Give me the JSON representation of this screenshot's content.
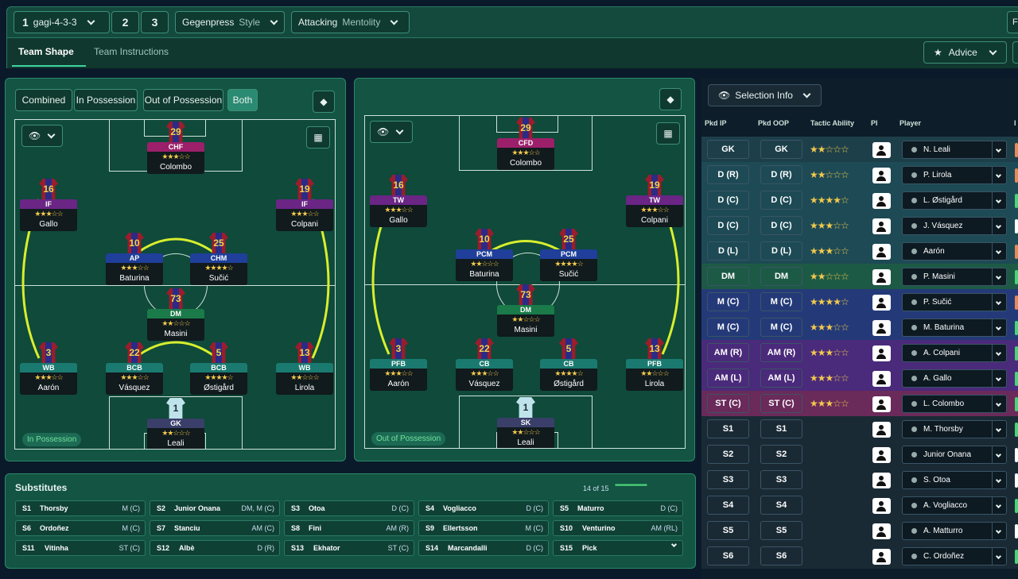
{
  "topbar": {
    "formation_num": "1",
    "formation_name": "gagi-4-3-3",
    "tab2": "2",
    "tab3": "3",
    "style_value": "Gegenpress",
    "style_label": "Style",
    "mentality_value": "Attacking",
    "mentality_label": "Mentolity",
    "far_right": "Fo"
  },
  "tabs": {
    "team_shape": "Team Shape",
    "team_instructions": "Team Instructions",
    "advice": "Advice"
  },
  "view_toggle": {
    "combined": "Combined",
    "in_possession": "In Possession",
    "out_of_possession": "Out of Possession",
    "both": "Both"
  },
  "left_pitch": {
    "label": "In Possession",
    "players": [
      {
        "num": "29",
        "role": "CHF",
        "name": "Colombo",
        "stars": "★★★☆☆",
        "color": "role-magenta"
      },
      {
        "num": "16",
        "role": "IF",
        "name": "Gallo",
        "stars": "★★★☆☆",
        "color": "role-purple"
      },
      {
        "num": "19",
        "role": "IF",
        "name": "Colpani",
        "stars": "★★★☆☆",
        "color": "role-purple"
      },
      {
        "num": "10",
        "role": "AP",
        "name": "Baturina",
        "stars": "★★★☆☆",
        "color": "role-blue"
      },
      {
        "num": "25",
        "role": "CHM",
        "name": "Sučić",
        "stars": "★★★★☆",
        "color": "role-blue"
      },
      {
        "num": "73",
        "role": "DM",
        "name": "Masini",
        "stars": "★★☆☆☆",
        "color": "role-green"
      },
      {
        "num": "3",
        "role": "WB",
        "name": "Aarón",
        "stars": "★★★☆☆",
        "color": "role-teal"
      },
      {
        "num": "22",
        "role": "BCB",
        "name": "Vásquez",
        "stars": "★★★☆☆",
        "color": "role-teal"
      },
      {
        "num": "5",
        "role": "BCB",
        "name": "Østigård",
        "stars": "★★★★☆",
        "color": "role-teal"
      },
      {
        "num": "13",
        "role": "WB",
        "name": "Lirola",
        "stars": "★★☆☆☆",
        "color": "role-teal"
      },
      {
        "num": "1",
        "role": "GK",
        "name": "Leali",
        "stars": "★★☆☆☆",
        "color": "role-gk"
      }
    ]
  },
  "right_pitch": {
    "label": "Out of Possession",
    "players": [
      {
        "num": "29",
        "role": "CFD",
        "name": "Colombo",
        "stars": "★★★☆☆",
        "color": "role-magenta"
      },
      {
        "num": "16",
        "role": "TW",
        "name": "Gallo",
        "stars": "★★★☆☆",
        "color": "role-purple"
      },
      {
        "num": "19",
        "role": "TW",
        "name": "Colpani",
        "stars": "★★★☆☆",
        "color": "role-purple"
      },
      {
        "num": "10",
        "role": "PCM",
        "name": "Baturina",
        "stars": "★★☆☆☆",
        "color": "role-blue"
      },
      {
        "num": "25",
        "role": "PCM",
        "name": "Sučić",
        "stars": "★★★★☆",
        "color": "role-blue"
      },
      {
        "num": "73",
        "role": "DM",
        "name": "Masini",
        "stars": "★★☆☆☆",
        "color": "role-green"
      },
      {
        "num": "3",
        "role": "PFB",
        "name": "Aarón",
        "stars": "★★★☆☆",
        "color": "role-teal"
      },
      {
        "num": "22",
        "role": "CB",
        "name": "Vásquez",
        "stars": "★★★☆☆",
        "color": "role-teal"
      },
      {
        "num": "5",
        "role": "CB",
        "name": "Østigård",
        "stars": "★★★★☆",
        "color": "role-teal"
      },
      {
        "num": "13",
        "role": "PFB",
        "name": "Lirola",
        "stars": "★★☆☆☆",
        "color": "role-teal"
      },
      {
        "num": "1",
        "role": "SK",
        "name": "Leali",
        "stars": "★★☆☆☆",
        "color": "role-gk"
      }
    ]
  },
  "substitutes": {
    "title": "Substitutes",
    "count": "14 of 15",
    "rows": [
      {
        "slot": "S1",
        "name": "Thorsby",
        "pos": "M (C)"
      },
      {
        "slot": "S2",
        "name": "Junior Onana",
        "pos": "DM, M (C)"
      },
      {
        "slot": "S3",
        "name": "Otoa",
        "pos": "D (C)"
      },
      {
        "slot": "S4",
        "name": "Vogliacco",
        "pos": "D (C)"
      },
      {
        "slot": "S5",
        "name": "Maturro",
        "pos": "D (C)"
      },
      {
        "slot": "S6",
        "name": "Ordoñez",
        "pos": "M (C)"
      },
      {
        "slot": "S7",
        "name": "Stanciu",
        "pos": "AM (C)"
      },
      {
        "slot": "S8",
        "name": "Fini",
        "pos": "AM (R)"
      },
      {
        "slot": "S9",
        "name": "Ellertsson",
        "pos": "M (C)"
      },
      {
        "slot": "S10",
        "name": "Venturino",
        "pos": "AM (RL)"
      },
      {
        "slot": "S11",
        "name": "Vitinha",
        "pos": "ST (C)"
      },
      {
        "slot": "S12",
        "name": "Albè",
        "pos": "D (R)"
      },
      {
        "slot": "S13",
        "name": "Ekhator",
        "pos": "ST (C)"
      },
      {
        "slot": "S14",
        "name": "Marcandalli",
        "pos": "D (C)"
      },
      {
        "slot": "S15",
        "name": "Pick",
        "pos": ""
      }
    ]
  },
  "selection": {
    "title": "Selection Info",
    "headers": {
      "pkd_ip": "Pkd IP",
      "pkd_oop": "Pkd OOP",
      "tactic": "Tactic Ability",
      "pi": "PI",
      "player": "Player",
      "extra": "I"
    },
    "rows": [
      {
        "ip": "GK",
        "oop": "GK",
        "stars": "★★☆☆☆",
        "player": "N. Leali",
        "bg": "#1d3f4a",
        "edge": "#e58a5a"
      },
      {
        "ip": "D (R)",
        "oop": "D (R)",
        "stars": "★★☆☆☆",
        "player": "P. Lirola",
        "bg": "#1d4a55",
        "edge": "#e58a5a"
      },
      {
        "ip": "D (C)",
        "oop": "D (C)",
        "stars": "★★★★☆",
        "player": "L. Østigård",
        "bg": "#1d4a55",
        "edge": "#4cd37a"
      },
      {
        "ip": "D (C)",
        "oop": "D (C)",
        "stars": "★★★☆☆",
        "player": "J. Vásquez",
        "bg": "#1d4a55",
        "edge": "#ffffff"
      },
      {
        "ip": "D (L)",
        "oop": "D (L)",
        "stars": "★★★☆☆",
        "player": "Aarón",
        "bg": "#1d4a55",
        "edge": "#e58a5a"
      },
      {
        "ip": "DM",
        "oop": "DM",
        "stars": "★★☆☆☆",
        "player": "P. Masini",
        "bg": "#1d5a45",
        "edge": "#4cd37a"
      },
      {
        "ip": "M (C)",
        "oop": "M (C)",
        "stars": "★★★★☆",
        "player": "P. Sučić",
        "bg": "#243a78",
        "edge": "#e58a5a"
      },
      {
        "ip": "M (C)",
        "oop": "M (C)",
        "stars": "★★★☆☆",
        "player": "M. Baturina",
        "bg": "#243a78",
        "edge": "#4cd37a"
      },
      {
        "ip": "AM (R)",
        "oop": "AM (R)",
        "stars": "★★★☆☆",
        "player": "A. Colpani",
        "bg": "#4a2a7a",
        "edge": "#4cd37a"
      },
      {
        "ip": "AM (L)",
        "oop": "AM (L)",
        "stars": "★★★☆☆",
        "player": "A. Gallo",
        "bg": "#4a2a7a",
        "edge": "#4cd37a"
      },
      {
        "ip": "ST (C)",
        "oop": "ST (C)",
        "stars": "★★★☆☆",
        "player": "L. Colombo",
        "bg": "#6a2a5a",
        "edge": "#4cd37a"
      },
      {
        "ip": "S1",
        "oop": "S1",
        "stars": "",
        "player": "M. Thorsby",
        "bg": "#1a2a35",
        "edge": "#4cd37a"
      },
      {
        "ip": "S2",
        "oop": "S2",
        "stars": "",
        "player": "Junior Onana",
        "bg": "#1a2a35",
        "edge": "#ffffff"
      },
      {
        "ip": "S3",
        "oop": "S3",
        "stars": "",
        "player": "S. Otoa",
        "bg": "#1a2a35",
        "edge": "#ffffff"
      },
      {
        "ip": "S4",
        "oop": "S4",
        "stars": "",
        "player": "A. Vogliacco",
        "bg": "#1a2a35",
        "edge": "#4cd37a"
      },
      {
        "ip": "S5",
        "oop": "S5",
        "stars": "",
        "player": "A. Matturro",
        "bg": "#1a2a35",
        "edge": "#ffffff"
      },
      {
        "ip": "S6",
        "oop": "S6",
        "stars": "",
        "player": "C. Ordoñez",
        "bg": "#1a2a35",
        "edge": "#4cd37a"
      }
    ]
  }
}
